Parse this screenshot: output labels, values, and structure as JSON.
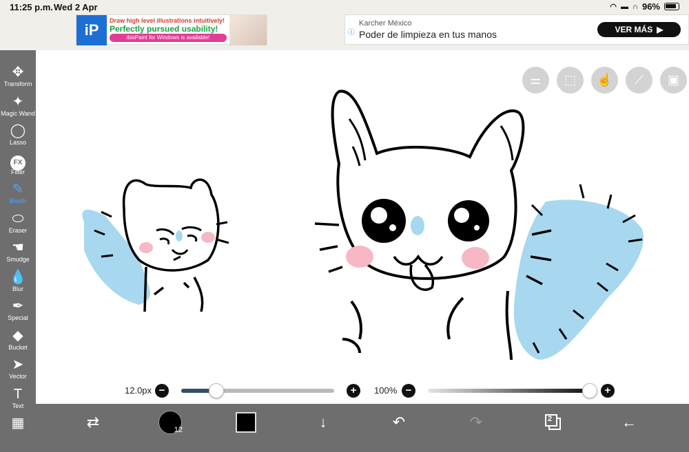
{
  "status": {
    "time": "11:25 p.m.",
    "date": "Wed 2 Apr",
    "battery": "96%"
  },
  "ads": {
    "left": {
      "line1": "Draw high level illustrations intuitively!",
      "line2": "Perfectly pursued usability!",
      "line3": "ibisPaint for Windows is available!"
    },
    "right": {
      "brand": "Karcher México",
      "headline": "Poder de limpieza en tus manos",
      "cta": "VER MÁS"
    }
  },
  "tools": [
    {
      "label": "Transform",
      "icon": "move-arrows-icon",
      "glyph": "✥"
    },
    {
      "label": "Magic Wand",
      "icon": "magic-wand-icon",
      "glyph": "✦"
    },
    {
      "label": "Lasso",
      "icon": "lasso-icon",
      "glyph": "◯"
    },
    {
      "label": "Filter",
      "icon": "fx-icon",
      "glyph": "FX"
    },
    {
      "label": "Brush",
      "icon": "brush-icon",
      "glyph": "✎",
      "active": true
    },
    {
      "label": "Eraser",
      "icon": "eraser-icon",
      "glyph": "⬭"
    },
    {
      "label": "Smudge",
      "icon": "smudge-icon",
      "glyph": "☚"
    },
    {
      "label": "Blur",
      "icon": "blur-drop-icon",
      "glyph": "💧"
    },
    {
      "label": "Special",
      "icon": "special-pen-icon",
      "glyph": "✒"
    },
    {
      "label": "Bucket",
      "icon": "bucket-icon",
      "glyph": "◆"
    },
    {
      "label": "Vector",
      "icon": "vector-cursor-icon",
      "glyph": "➤"
    },
    {
      "label": "Text",
      "icon": "text-icon",
      "glyph": "T"
    },
    {
      "label": "",
      "icon": "frame-divider-icon",
      "glyph": "▦"
    }
  ],
  "quick_buttons": [
    {
      "icon": "toggle-settings-icon",
      "glyph": "⚌"
    },
    {
      "icon": "selection-icon",
      "glyph": "⬚"
    },
    {
      "icon": "hand-touch-icon",
      "glyph": "☝"
    },
    {
      "icon": "ruler-icon",
      "glyph": "⟋"
    },
    {
      "icon": "image-icon",
      "glyph": "▣"
    }
  ],
  "brush_size": {
    "label": "12.0px",
    "fraction": 0.23
  },
  "opacity": {
    "label": "100%",
    "fraction": 1.0
  },
  "bottom_bar": {
    "brush_number": "12",
    "color": "#000000",
    "layer_count": "2",
    "icons": {
      "swap": "swap-tools-icon",
      "download": "down-arrow-icon",
      "undo": "undo-icon",
      "redo": "redo-icon",
      "back": "back-arrow-icon"
    }
  },
  "colors": {
    "toolbar": "#6e6e6e",
    "active_tool": "#4aa8ff",
    "fur_blue": "#a8d8f0",
    "cheek_pink": "#f6b8c4"
  }
}
